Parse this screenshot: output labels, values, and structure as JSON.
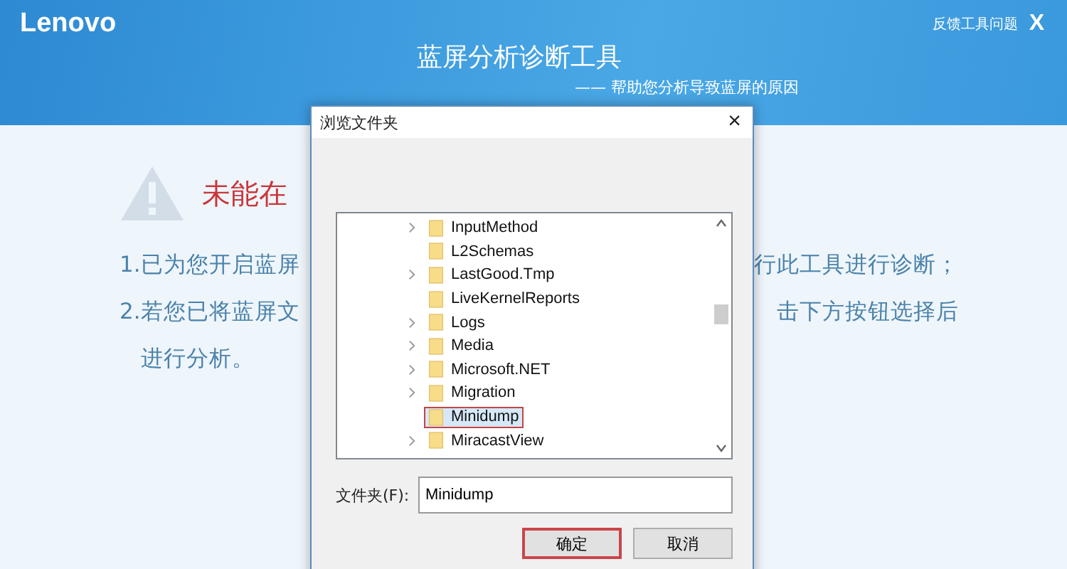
{
  "app": {
    "logo": "Lenovo",
    "feedback": "反馈工具问题",
    "close": "X",
    "title": "蓝屏分析诊断工具",
    "subtitle": "—— 帮助您分析导致蓝屏的原因"
  },
  "content": {
    "warning": "未能在",
    "lines": [
      {
        "left": "1.已为您开启蓝屏",
        "right": "行此工具进行诊断；"
      },
      {
        "left": "2.若您已将蓝屏文",
        "right": "击下方按钮选择后"
      }
    ],
    "continuation": "进行分析。"
  },
  "dialog": {
    "title": "浏览文件夹",
    "close": "×",
    "folders": [
      {
        "name": "InputMethod",
        "expandable": true,
        "selected": false
      },
      {
        "name": "L2Schemas",
        "expandable": false,
        "selected": false
      },
      {
        "name": "LastGood.Tmp",
        "expandable": true,
        "selected": false
      },
      {
        "name": "LiveKernelReports",
        "expandable": false,
        "selected": false
      },
      {
        "name": "Logs",
        "expandable": true,
        "selected": false
      },
      {
        "name": "Media",
        "expandable": true,
        "selected": false
      },
      {
        "name": "Microsoft.NET",
        "expandable": true,
        "selected": false
      },
      {
        "name": "Migration",
        "expandable": true,
        "selected": false
      },
      {
        "name": "Minidump",
        "expandable": false,
        "selected": true
      },
      {
        "name": "MiracastView",
        "expandable": true,
        "selected": false
      }
    ],
    "folder_label": "文件夹(F):",
    "folder_value": "Minidump",
    "buttons": [
      {
        "label": "确定",
        "highlighted": true
      },
      {
        "label": "取消",
        "highlighted": false
      }
    ]
  }
}
